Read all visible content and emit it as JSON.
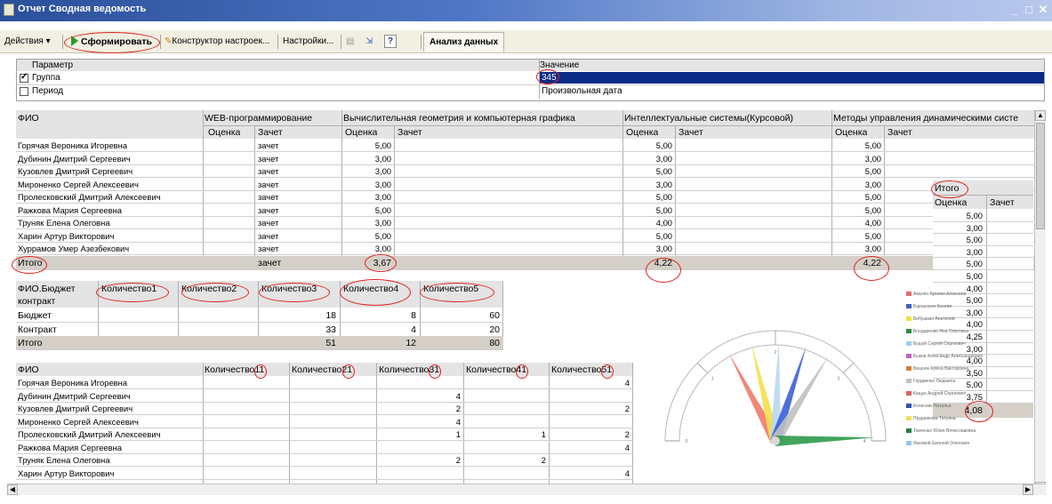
{
  "window": {
    "title": "Отчет  Сводная ведомость",
    "minimize": "_",
    "maximize": "□",
    "close": "✕"
  },
  "toolbar": {
    "actions": "Действия",
    "generate": "Сформировать",
    "constructor": "Конструктор настроек...",
    "settings": "Настройки...",
    "help": "?",
    "tab_analysis": "Анализ данных"
  },
  "params": {
    "col_param": "Параметр",
    "col_value": "Значение",
    "rows": [
      {
        "checked": true,
        "name": "Группа",
        "value": "345"
      },
      {
        "checked": false,
        "name": "Период",
        "value": "Произвольная дата"
      }
    ]
  },
  "report1": {
    "fio_header": "ФИО",
    "subjects": [
      "WEB-программирование",
      "Вычислительная геометрия и компьютерная графика",
      "Интеллектуальные системы(Курсовой)",
      "Методы управления динамическими систе"
    ],
    "sub_ocenka": "Оценка",
    "sub_zachet": "Зачет",
    "students": [
      {
        "fio": "Горячая Вероника Игоревна",
        "web": "зачет",
        "g": "5,00",
        "i": "5,00",
        "m": "5,00"
      },
      {
        "fio": "Дубинин Дмитрий Сергеевич",
        "web": "зачет",
        "g": "3,00",
        "i": "3,00",
        "m": "3,00"
      },
      {
        "fio": "Кузовлев Дмитрий Сергеевич",
        "web": "зачет",
        "g": "3,00",
        "i": "5,00",
        "m": "5,00"
      },
      {
        "fio": "Мироненко Сергей Алексеевич",
        "web": "зачет",
        "g": "3,00",
        "i": "3,00",
        "m": "3,00"
      },
      {
        "fio": "Пролесковский Дмитрий Алексеевич",
        "web": "зачет",
        "g": "3,00",
        "i": "5,00",
        "m": "5,00"
      },
      {
        "fio": "Ражкова Мария Сергеевна",
        "web": "зачет",
        "g": "5,00",
        "i": "5,00",
        "m": "5,00"
      },
      {
        "fio": "Труняк Елена Олеговна",
        "web": "зачет",
        "g": "3,00",
        "i": "4,00",
        "m": "4,00"
      },
      {
        "fio": "Харин Артур Викторович",
        "web": "зачет",
        "g": "5,00",
        "i": "5,00",
        "m": "5,00"
      },
      {
        "fio": "Хуррамов Умер Азезбекович",
        "web": "зачет",
        "g": "3,00",
        "i": "3,00",
        "m": "3,00"
      }
    ],
    "total_label": "Итого",
    "total_web": "зачет",
    "total_g": "3,67",
    "total_i": "4,22",
    "total_m": "4,22"
  },
  "itogo_panel": {
    "title": "Итого",
    "col_ocenka": "Оценка",
    "col_zachet": "Зачет",
    "values": [
      "5,00",
      "3,00",
      "5,00",
      "3,00",
      "5,00",
      "5,00",
      "4,00",
      "5,00",
      "3,00",
      "4,00",
      "4,25",
      "3,00",
      "4,00",
      "3,50",
      "5,00",
      "3,75"
    ],
    "total": "4,08"
  },
  "budget": {
    "col0_line1": "ФИО.Бюджет",
    "col0_line2": "контракт",
    "cols": [
      "Количество1",
      "Количество2",
      "Количество3",
      "Количество4",
      "Количество5"
    ],
    "rows": [
      {
        "label": "Бюджет",
        "c3": "18",
        "c4": "8",
        "c5": "60"
      },
      {
        "label": "Контракт",
        "c3": "33",
        "c4": "4",
        "c5": "20"
      },
      {
        "label": "Итого",
        "c3": "51",
        "c4": "12",
        "c5": "80"
      }
    ]
  },
  "report2": {
    "fio_header": "ФИО",
    "cols": [
      "Количество11",
      "Количество21",
      "Количество31",
      "Количество41",
      "Количество51"
    ],
    "rows": [
      {
        "fio": "Горячая Вероника Игоревна",
        "c3": "",
        "c4": "",
        "c5": "4"
      },
      {
        "fio": "Дубинин Дмитрий Сергеевич",
        "c3": "4",
        "c4": "",
        "c5": ""
      },
      {
        "fio": "Кузовлев Дмитрий Сергеевич",
        "c3": "2",
        "c4": "",
        "c5": "2"
      },
      {
        "fio": "Мироненко Сергей Алексеевич",
        "c3": "4",
        "c4": "",
        "c5": ""
      },
      {
        "fio": "Пролесковский Дмитрий Алексеевич",
        "c3": "1",
        "c4": "1",
        "c5": "2"
      },
      {
        "fio": "Ражкова Мария Сергеевна",
        "c3": "",
        "c4": "",
        "c5": "4"
      },
      {
        "fio": "Труняк Елена Олеговна",
        "c3": "2",
        "c4": "2",
        "c5": ""
      },
      {
        "fio": "Харин Артур Викторович",
        "c3": "",
        "c4": "",
        "c5": "4"
      }
    ]
  },
  "gauge": {
    "scale_labels": [
      "0",
      "1",
      "2",
      "3",
      "4"
    ],
    "needle_colors": [
      "#f07a6a",
      "#f4e04a",
      "#b8d8f0",
      "#3a5fd8",
      "#c0c0c0",
      "#2e9a4a"
    ],
    "legend": [
      {
        "color": "#e86a6a",
        "text": "Авалян Артемо Алексеев"
      },
      {
        "color": "#4060c0",
        "text": "Баранович Ксения"
      },
      {
        "color": "#f0e040",
        "text": "Бибушкин Анатолий"
      },
      {
        "color": "#2a8a40",
        "text": "Бондаренко Яна Олеговна"
      },
      {
        "color": "#a0d0f0",
        "text": "Бушуй Сергей Сергеевич"
      },
      {
        "color": "#c060c0",
        "text": "Быков Александр Александрович"
      },
      {
        "color": "#d08040",
        "text": "Вешняк Алена Викторовна"
      },
      {
        "color": "#c0c0c0",
        "text": "Гордиенко Людмила"
      },
      {
        "color": "#e06060",
        "text": "Кащук Андрей Сергеевич"
      },
      {
        "color": "#3050b0",
        "text": "Колесник Наталья"
      },
      {
        "color": "#f0e060",
        "text": "Прудникова Татьяна"
      },
      {
        "color": "#208040",
        "text": "Ткаченко Юлия Вячеславовна"
      },
      {
        "color": "#90c8f0",
        "text": "Янковой Евгений Олегович"
      }
    ]
  }
}
